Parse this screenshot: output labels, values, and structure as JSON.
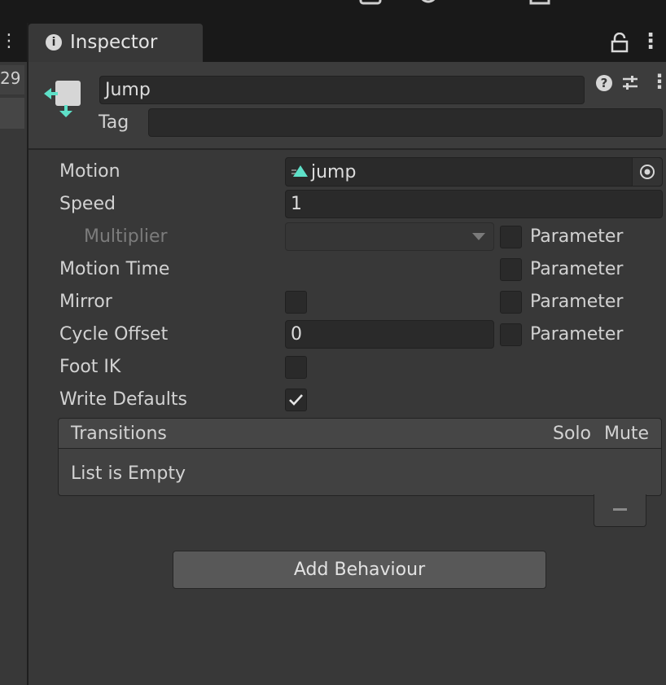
{
  "left_panel": {
    "value": "29"
  },
  "tab": {
    "title": "Inspector"
  },
  "header": {
    "name_value": "Jump",
    "tag_label": "Tag",
    "tag_value": ""
  },
  "fields": {
    "motion_label": "Motion",
    "motion_value": "jump",
    "speed_label": "Speed",
    "speed_value": "1",
    "multiplier_label": "Multiplier",
    "multiplier_value": "",
    "motion_time_label": "Motion Time",
    "mirror_label": "Mirror",
    "cycle_offset_label": "Cycle Offset",
    "cycle_offset_value": "0",
    "foot_ik_label": "Foot IK",
    "write_defaults_label": "Write Defaults",
    "parameter_label": "Parameter"
  },
  "checkboxes": {
    "multiplier_parameter": false,
    "motion_time_parameter": false,
    "mirror": false,
    "mirror_parameter": false,
    "cycle_offset_parameter": false,
    "foot_ik": false,
    "write_defaults": true
  },
  "transitions": {
    "title": "Transitions",
    "solo_label": "Solo",
    "mute_label": "Mute",
    "empty_text": "List is Empty",
    "remove_label": "–"
  },
  "add_behaviour_label": "Add Behaviour",
  "colors": {
    "accent_teal": "#5ee0c8",
    "panel_bg": "#383838",
    "field_bg": "#2a2a2a"
  }
}
